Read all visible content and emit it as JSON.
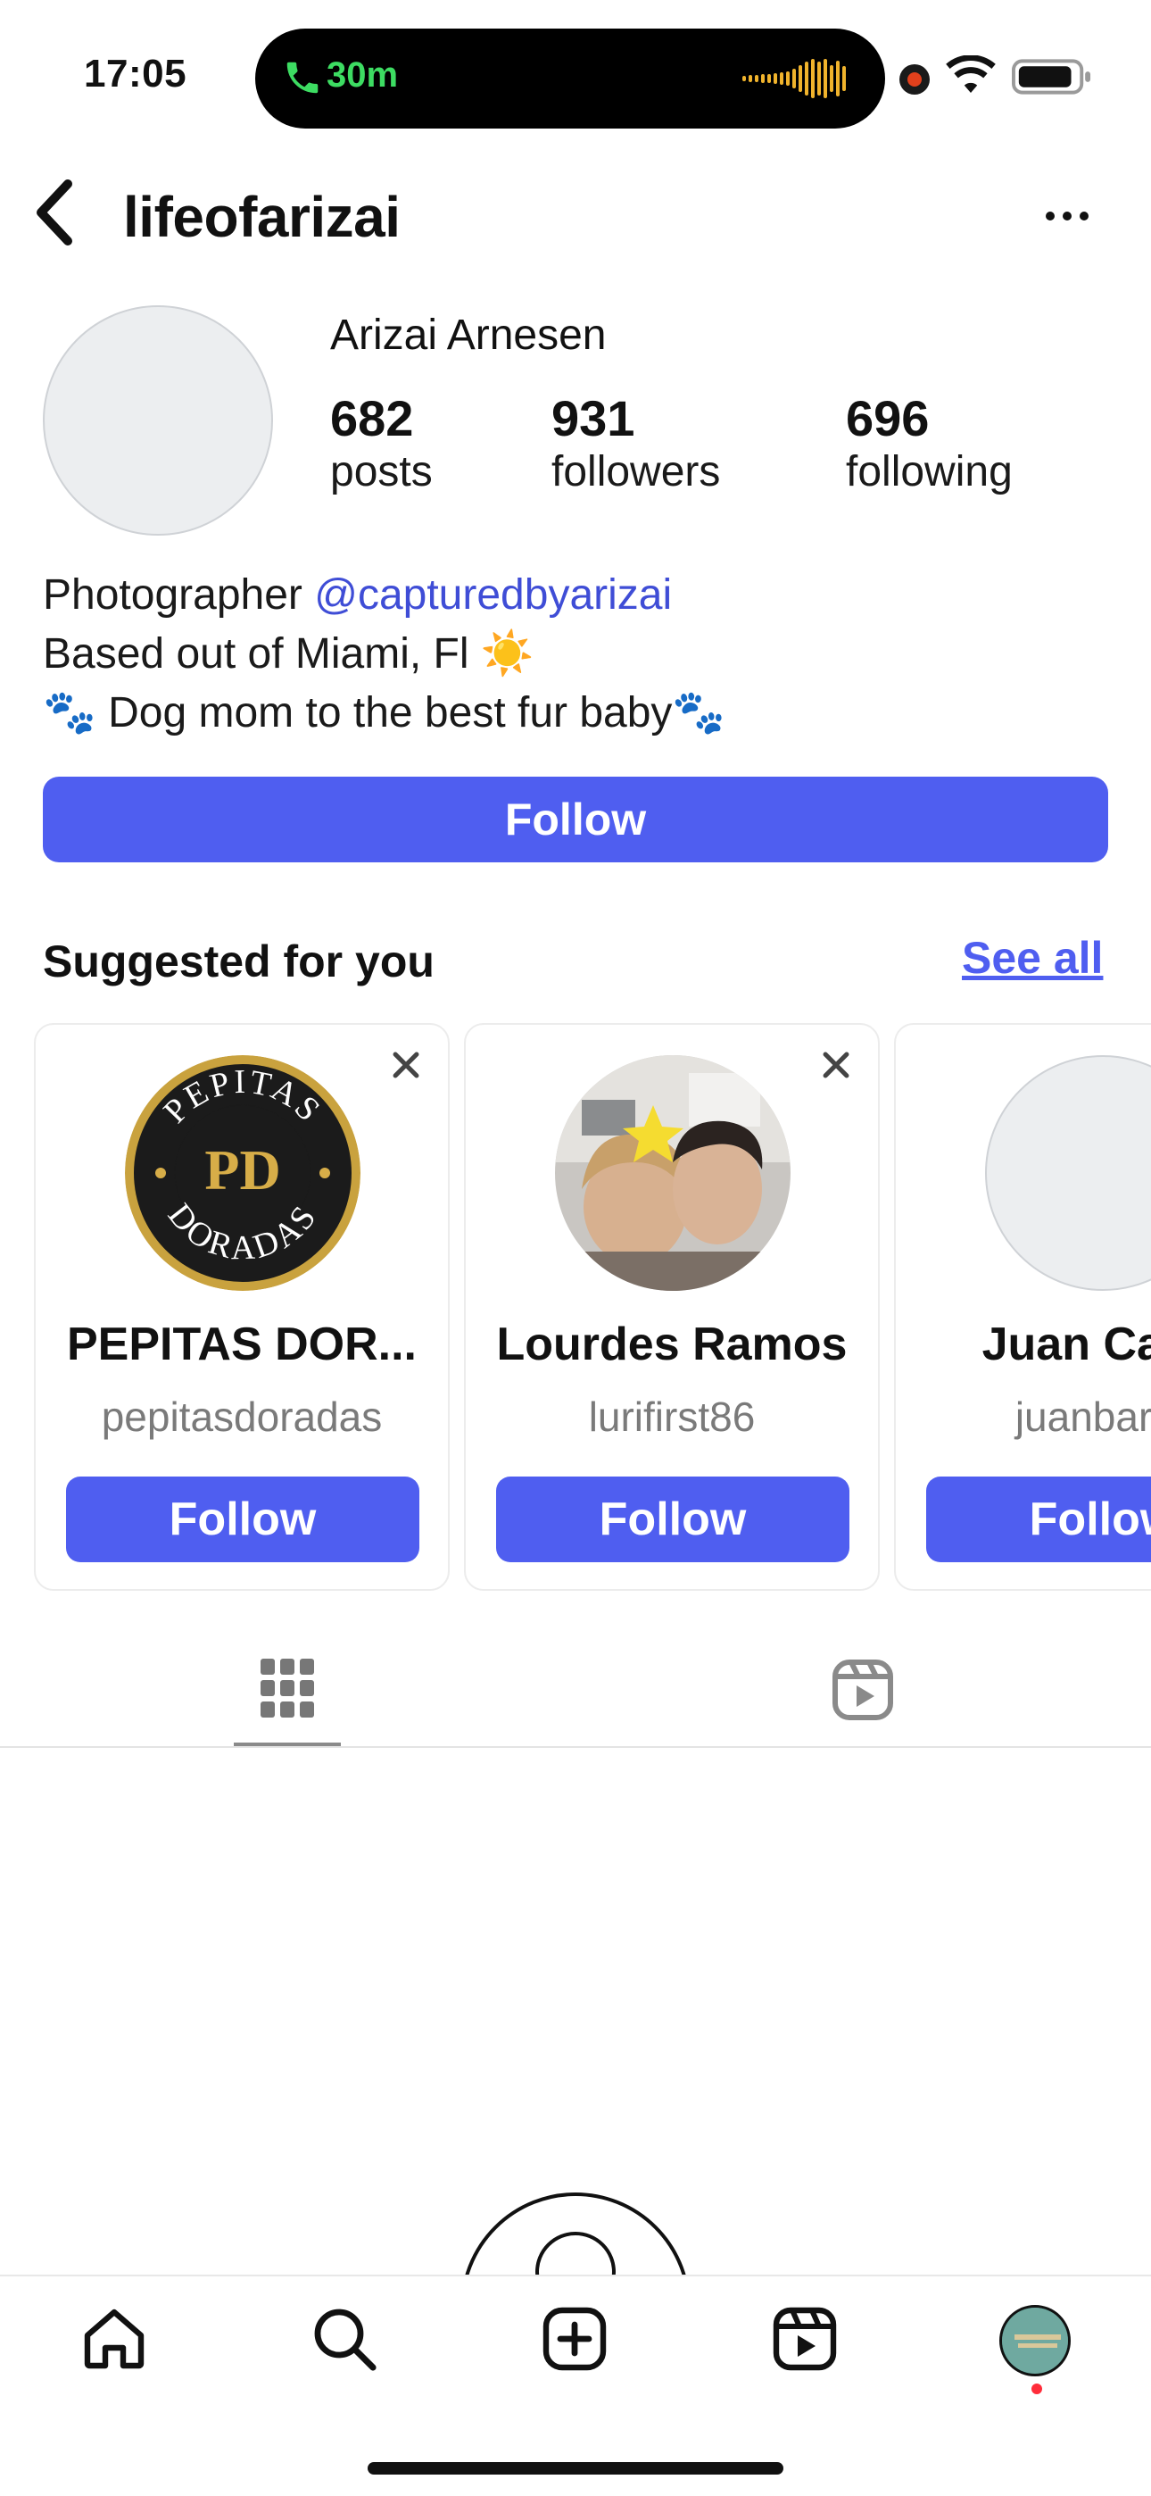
{
  "status_bar": {
    "time": "17:05",
    "call_duration": "30m"
  },
  "header": {
    "username": "lifeofarizai"
  },
  "profile": {
    "full_name": "Arizai Arnesen",
    "stats": [
      {
        "value": "682",
        "label": "posts"
      },
      {
        "value": "931",
        "label": "followers"
      },
      {
        "value": "696",
        "label": "following"
      }
    ],
    "bio": {
      "line1_prefix": "Photographer ",
      "line1_mention": "@capturedbyarizai",
      "line2": "Based out of Miami, Fl ☀️",
      "line3": "🐾 Dog mom to the best fur baby🐾"
    },
    "follow_label": "Follow"
  },
  "suggested": {
    "title": "Suggested for you",
    "see_all_label": "See all",
    "cards": [
      {
        "name": "PEPITAS DOR...",
        "handle": "pepitasdoradas",
        "follow_label": "Follow",
        "logo_top": "PEPITAS",
        "logo_mono": "PD",
        "logo_bottom": "DORADAS"
      },
      {
        "name": "Lourdes Ramos",
        "handle": "lurifirst86",
        "follow_label": "Follow"
      },
      {
        "name": "Juan Carlo",
        "handle": "juanbarro",
        "follow_label": "Follow"
      }
    ]
  },
  "tabs": {
    "active": "grid-tab",
    "items": [
      "grid-icon",
      "reels-icon"
    ]
  },
  "bottom_nav": {
    "items": [
      "home-icon",
      "search-icon",
      "create-icon",
      "reels-icon",
      "profile-avatar"
    ]
  },
  "colors": {
    "accent": "#4f5ef0",
    "mention": "#3f4dd6",
    "call_green": "#3ddc62",
    "notification_dot": "#ff2d3a"
  }
}
